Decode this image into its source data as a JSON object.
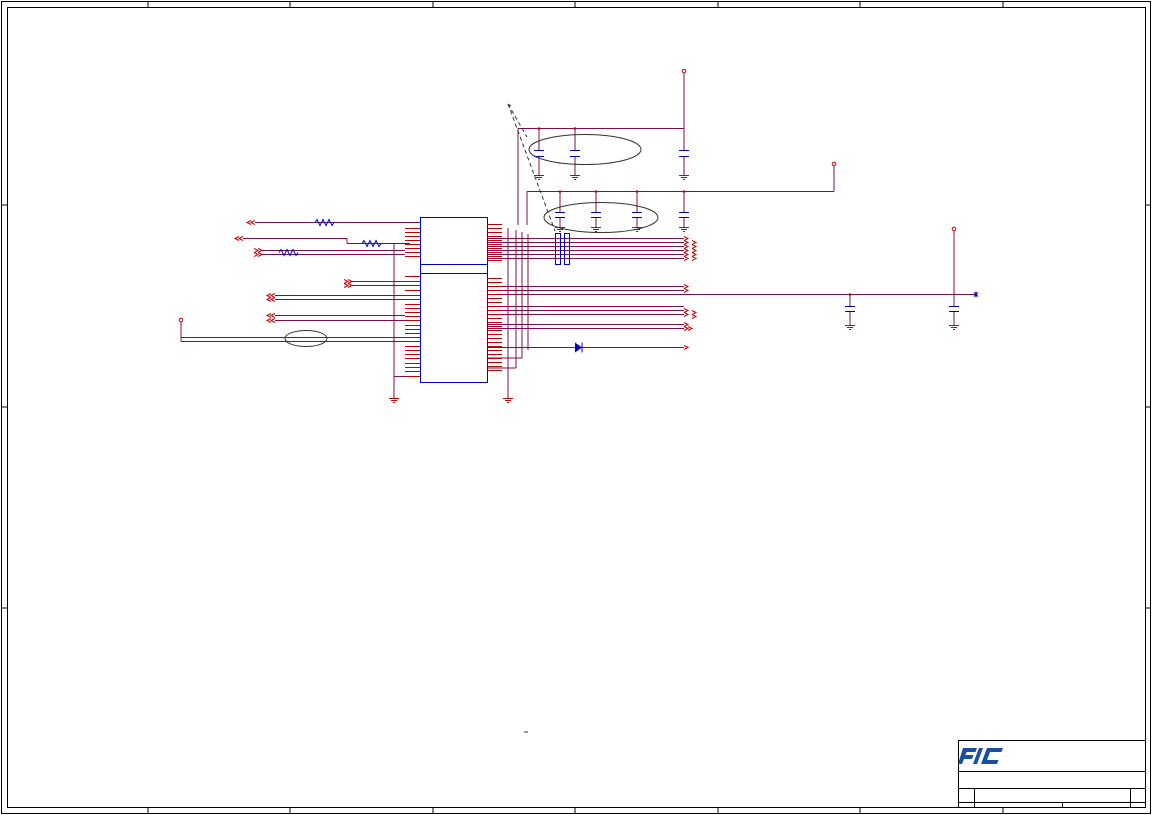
{
  "title_block": {
    "logo_text": "FIC",
    "logo_color": "#1a4fa0"
  },
  "colors": {
    "net": "#7b0f4e",
    "pin": "#c40000",
    "part": "#0000c0",
    "frame": "#000000",
    "annotation": "#333333"
  },
  "icons": [
    "ground-icon",
    "power-flag-icon",
    "capacitor-icon",
    "resistor-icon",
    "diode-icon",
    "off-page-connector-icon",
    "junction-dot-icon"
  ]
}
